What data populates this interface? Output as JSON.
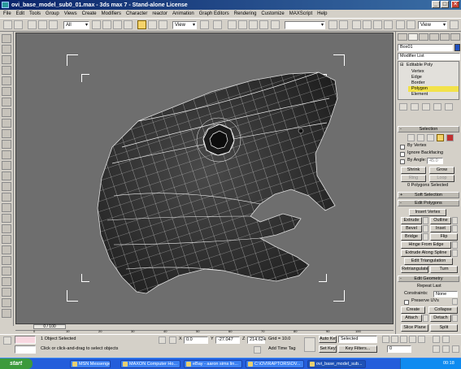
{
  "window": {
    "title": "ovi_base_model_sub0_01.max - 3ds max 7 - Stand-alone License",
    "min": "_",
    "max": "□",
    "close": "✕"
  },
  "menu": [
    "File",
    "Edit",
    "Tools",
    "Group",
    "Views",
    "Create",
    "Modifiers",
    "Character",
    "reactor",
    "Animation",
    "Graph Editors",
    "Rendering",
    "Customize",
    "MAXScript",
    "Help"
  ],
  "toolbar": {
    "selection_filter": "All",
    "reference_coord": "View",
    "named_selection": "",
    "viewport_dropdown": "View"
  },
  "command_panel": {
    "object_name": "Box01",
    "modifier_list": "Modifier List",
    "stack": {
      "base": "Editable Poly",
      "subobjects": [
        "Vertex",
        "Edge",
        "Border",
        "Polygon",
        "Element"
      ],
      "selected": "Polygon"
    },
    "selection_rollout": {
      "title": "Selection",
      "by_vertex": "By Vertex",
      "ignore_backfacing": "Ignore Backfacing",
      "by_angle": "By Angle:",
      "by_angle_value": "45.0",
      "shrink": "Shrink",
      "grow": "Grow",
      "ring": "Ring",
      "loop": "Loop",
      "status": "0 Polygons Selected"
    },
    "soft_selection": {
      "title": "Soft Selection",
      "sign": "+"
    },
    "edit_polygons": {
      "title": "Edit Polygons",
      "sign": "-",
      "insert_vertex": "Insert Vertex",
      "extrude": "Extrude",
      "outline": "Outline",
      "bevel": "Bevel",
      "inset": "Inset",
      "bridge": "Bridge",
      "flip": "Flip",
      "hinge_from_edge": "Hinge From Edge",
      "extrude_along_spline": "Extrude Along Spline",
      "edit_triangulation": "Edit Triangulation",
      "retriangulate": "Retriangulate",
      "turn": "Turn"
    },
    "edit_geometry": {
      "title": "Edit Geometry",
      "sign": "-",
      "repeat_last": "Repeat Last",
      "constraints": "Constraints:",
      "constraints_value": "None",
      "preserve_uvs": "Preserve UVs",
      "create": "Create",
      "collapse": "Collapse",
      "attach": "Attach",
      "detach": "Detach",
      "slice_plane": "Slice Plane",
      "split": "Split"
    }
  },
  "timeline": {
    "frame": "0 / 100",
    "ticks": [
      "0",
      "10",
      "20",
      "30",
      "40",
      "50",
      "60",
      "70",
      "80",
      "90",
      "100"
    ]
  },
  "status": {
    "selected_objects": "1 Object Selected",
    "prompt": "Click or click-and-drag to select objects",
    "x_label": "X",
    "x_value": "0.0",
    "y_label": "Y",
    "y_value": "-27.047",
    "z_label": "Z",
    "z_value": "214.624",
    "grid": "Grid = 10.0",
    "add_time_tag": "Add Time Tag",
    "auto_key": "Auto Key",
    "set_key": "Set Key",
    "selected_dropdown": "Selected",
    "key_filters": "Key Filters...",
    "frame_value": "0"
  },
  "taskbar": {
    "start": "start",
    "tasks": [
      "MSN Messenger",
      "MAXON Computer Ho...",
      "eBay - aaron sims lin...",
      "C:\\OVIRAPTORS\\OV...",
      "ovi_base_model_sub..."
    ],
    "clock": "00:18"
  }
}
